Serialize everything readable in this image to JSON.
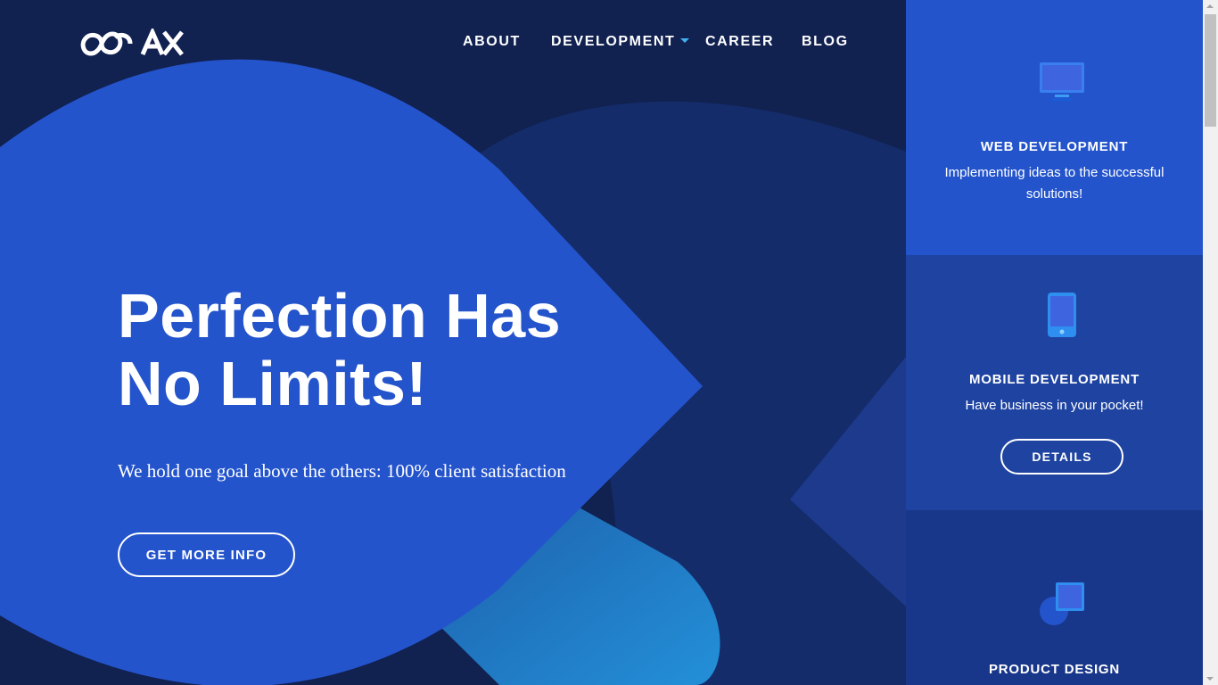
{
  "brand": {
    "logo_text": "COAX",
    "accent": "#3fb1f2",
    "primary_blue": "#2454cc",
    "navy": "#112150"
  },
  "nav": {
    "items": [
      {
        "label": "ABOUT"
      },
      {
        "label": "DEVELOPMENT",
        "has_dropdown": true
      },
      {
        "label": "CAREER"
      },
      {
        "label": "BLOG"
      }
    ]
  },
  "hero": {
    "headline_line1": "Perfection Has",
    "headline_line2": "No Limits!",
    "subtitle": "We hold one goal above the others: 100% client satisfaction",
    "cta_label": "GET MORE INFO"
  },
  "services": [
    {
      "title": "WEB DEVELOPMENT",
      "description": "Implementing ideas to the successful solutions!",
      "icon": "monitor-icon"
    },
    {
      "title": "MOBILE DEVELOPMENT",
      "description": "Have business in your pocket!",
      "button_label": "DETAILS",
      "icon": "tablet-icon"
    },
    {
      "title": "PRODUCT DESIGN",
      "icon": "shapes-icon"
    }
  ]
}
